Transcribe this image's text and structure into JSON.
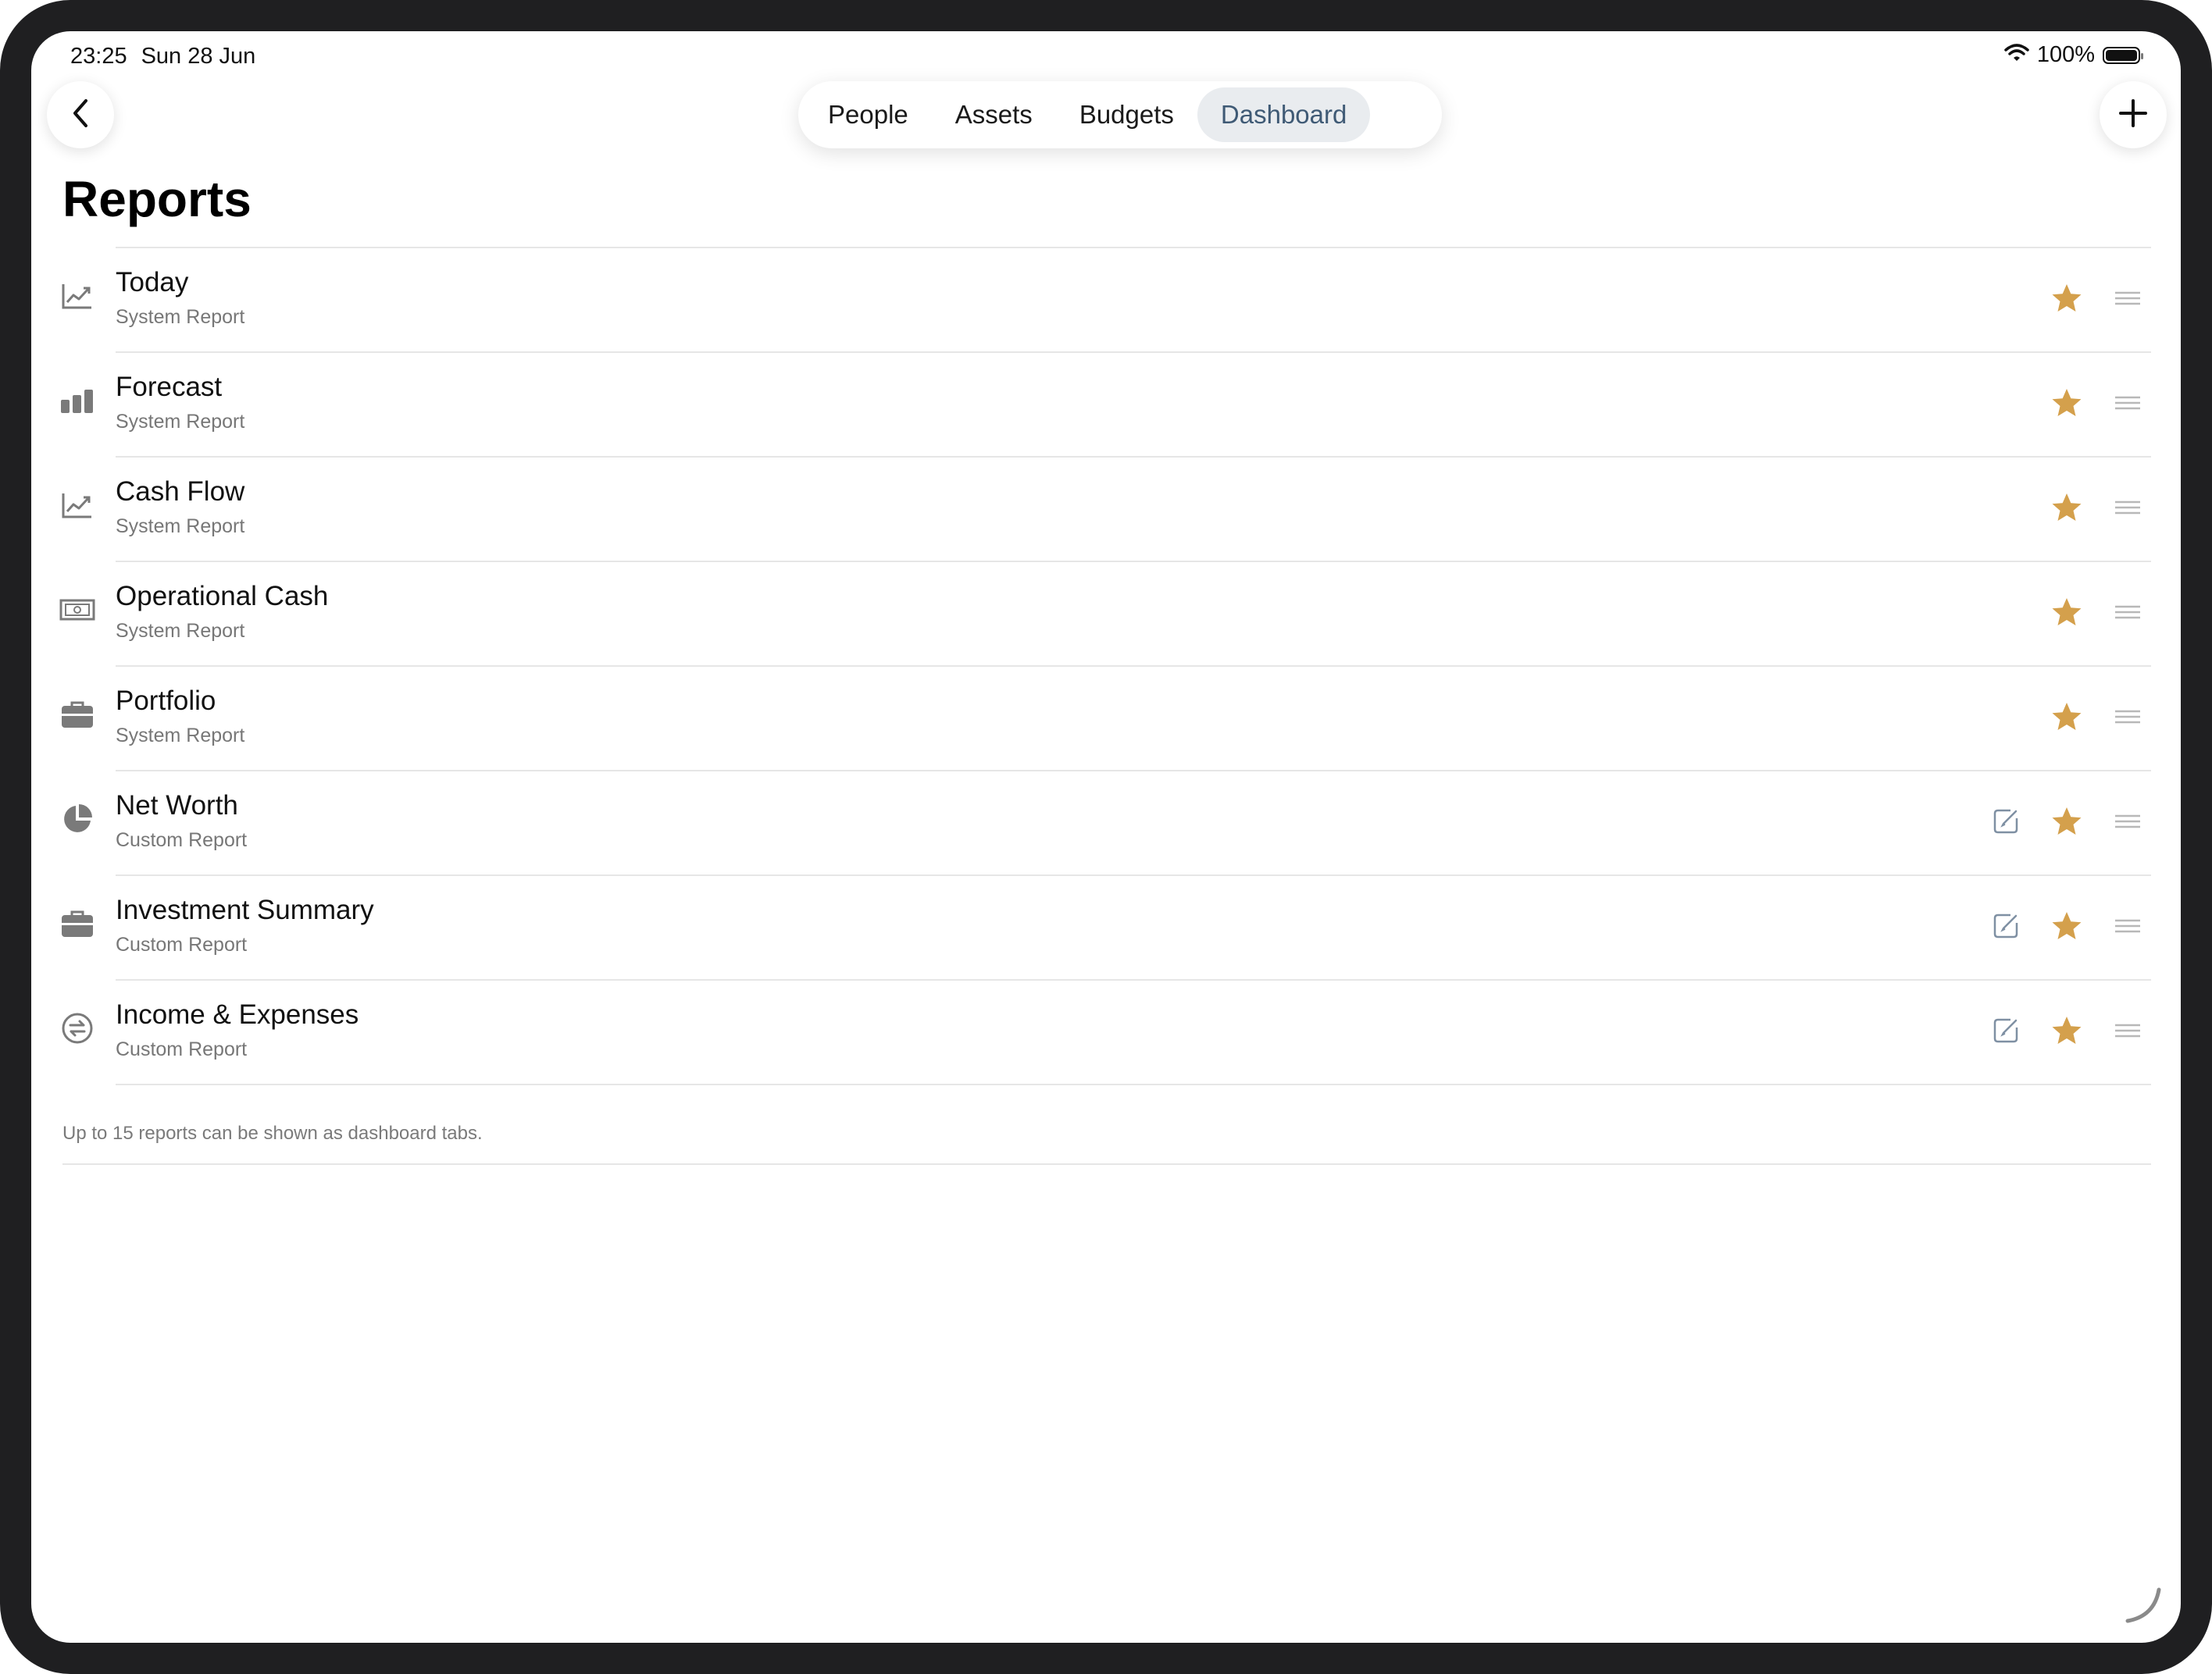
{
  "status_bar": {
    "time": "23:25",
    "date": "Sun 28 Jun",
    "battery": "100%"
  },
  "navigation": {
    "tabs": [
      {
        "label": "People",
        "active": false
      },
      {
        "label": "Assets",
        "active": false
      },
      {
        "label": "Budgets",
        "active": false
      },
      {
        "label": "Dashboard",
        "active": true
      }
    ]
  },
  "page": {
    "title": "Reports",
    "footer_note": "Up to 15 reports can be shown as dashboard tabs."
  },
  "reports": [
    {
      "title": "Today",
      "subtitle": "System Report",
      "icon": "line-chart-icon",
      "favorite": true,
      "editable": false
    },
    {
      "title": "Forecast",
      "subtitle": "System Report",
      "icon": "bar-chart-icon",
      "favorite": true,
      "editable": false
    },
    {
      "title": "Cash Flow",
      "subtitle": "System Report",
      "icon": "line-chart-icon",
      "favorite": true,
      "editable": false
    },
    {
      "title": "Operational Cash",
      "subtitle": "System Report",
      "icon": "banknote-icon",
      "favorite": true,
      "editable": false
    },
    {
      "title": "Portfolio",
      "subtitle": "System Report",
      "icon": "briefcase-icon",
      "favorite": true,
      "editable": false
    },
    {
      "title": "Net Worth",
      "subtitle": "Custom Report",
      "icon": "pie-chart-icon",
      "favorite": true,
      "editable": true
    },
    {
      "title": "Investment Summary",
      "subtitle": "Custom Report",
      "icon": "briefcase-icon",
      "favorite": true,
      "editable": true
    },
    {
      "title": "Income & Expenses",
      "subtitle": "Custom Report",
      "icon": "exchange-circle-icon",
      "favorite": true,
      "editable": true
    }
  ],
  "colors": {
    "star": "#d4a04c",
    "active_tab_text": "#3f5a75",
    "active_tab_bg": "#e9ecef",
    "icon_gray": "#7a7a7a",
    "handle_gray": "#b8b8b8"
  }
}
